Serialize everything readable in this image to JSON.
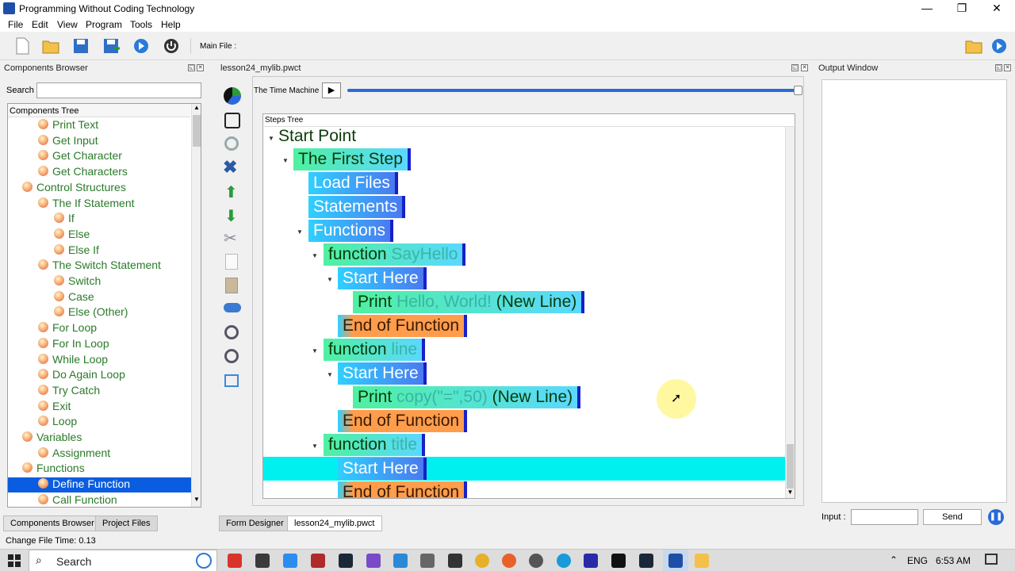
{
  "window": {
    "title": "Programming Without Coding Technology",
    "minimize": "—",
    "restore": "❐",
    "close": "✕"
  },
  "menu": [
    "File",
    "Edit",
    "View",
    "Program",
    "Tools",
    "Help"
  ],
  "toolbar": {
    "main_file_label": "Main File :"
  },
  "components_browser": {
    "title": "Components Browser",
    "search_label": "Search",
    "search_value": "",
    "tree_header": "Components Tree",
    "items": [
      {
        "label": "Print Text",
        "level": 2
      },
      {
        "label": "Get Input",
        "level": 2
      },
      {
        "label": "Get Character",
        "level": 2
      },
      {
        "label": "Get Characters",
        "level": 2
      },
      {
        "label": "Control Structures",
        "level": 1
      },
      {
        "label": "The If Statement",
        "level": 2
      },
      {
        "label": "If",
        "level": 3
      },
      {
        "label": "Else",
        "level": 3
      },
      {
        "label": "Else If",
        "level": 3
      },
      {
        "label": "The Switch Statement",
        "level": 2
      },
      {
        "label": "Switch",
        "level": 3
      },
      {
        "label": "Case",
        "level": 3
      },
      {
        "label": "Else (Other)",
        "level": 3
      },
      {
        "label": "For Loop",
        "level": 2
      },
      {
        "label": "For In Loop",
        "level": 2
      },
      {
        "label": "While Loop",
        "level": 2
      },
      {
        "label": "Do Again Loop",
        "level": 2
      },
      {
        "label": "Try Catch",
        "level": 2
      },
      {
        "label": "Exit",
        "level": 2
      },
      {
        "label": "Loop",
        "level": 2
      },
      {
        "label": "Variables",
        "level": 1
      },
      {
        "label": "Assignment",
        "level": 2
      },
      {
        "label": "Functions",
        "level": 1
      },
      {
        "label": "Define Function",
        "level": 2,
        "selected": true
      },
      {
        "label": "Call Function",
        "level": 2
      }
    ],
    "tabs": [
      "Components Browser",
      "Project Files"
    ]
  },
  "editor": {
    "file_title": "lesson24_mylib.pwct",
    "time_machine_label": "The Time Machine",
    "steps_tree_header": "Steps Tree",
    "root": "Start Point",
    "nodes": {
      "first_step": "The First Step",
      "load_files": "Load Files",
      "statements": "Statements",
      "functions": "Functions",
      "fn_kw": "function",
      "fn1_name": "SayHello",
      "start_here": "Start Here",
      "print_kw": "Print",
      "print1_arg": "Hello, World!",
      "new_line": "(New Line)",
      "end_of_function": "End of Function",
      "fn2_name": "line",
      "print2_arg": "copy(\"=\",50)",
      "fn3_name": "title"
    },
    "tabs": [
      "Form Designer",
      "lesson24_mylib.pwct"
    ]
  },
  "output": {
    "title": "Output Window",
    "input_label": "Input :",
    "input_value": "",
    "send_label": "Send"
  },
  "status": {
    "text": "Change File Time: 0.13"
  },
  "taskbar": {
    "search_label": "Search",
    "lang": "ENG",
    "time": "6:53 AM"
  },
  "colors": {
    "selection": "#0a5de0",
    "highlight_row": "#00f0f0",
    "node_border": "#1820c8"
  }
}
